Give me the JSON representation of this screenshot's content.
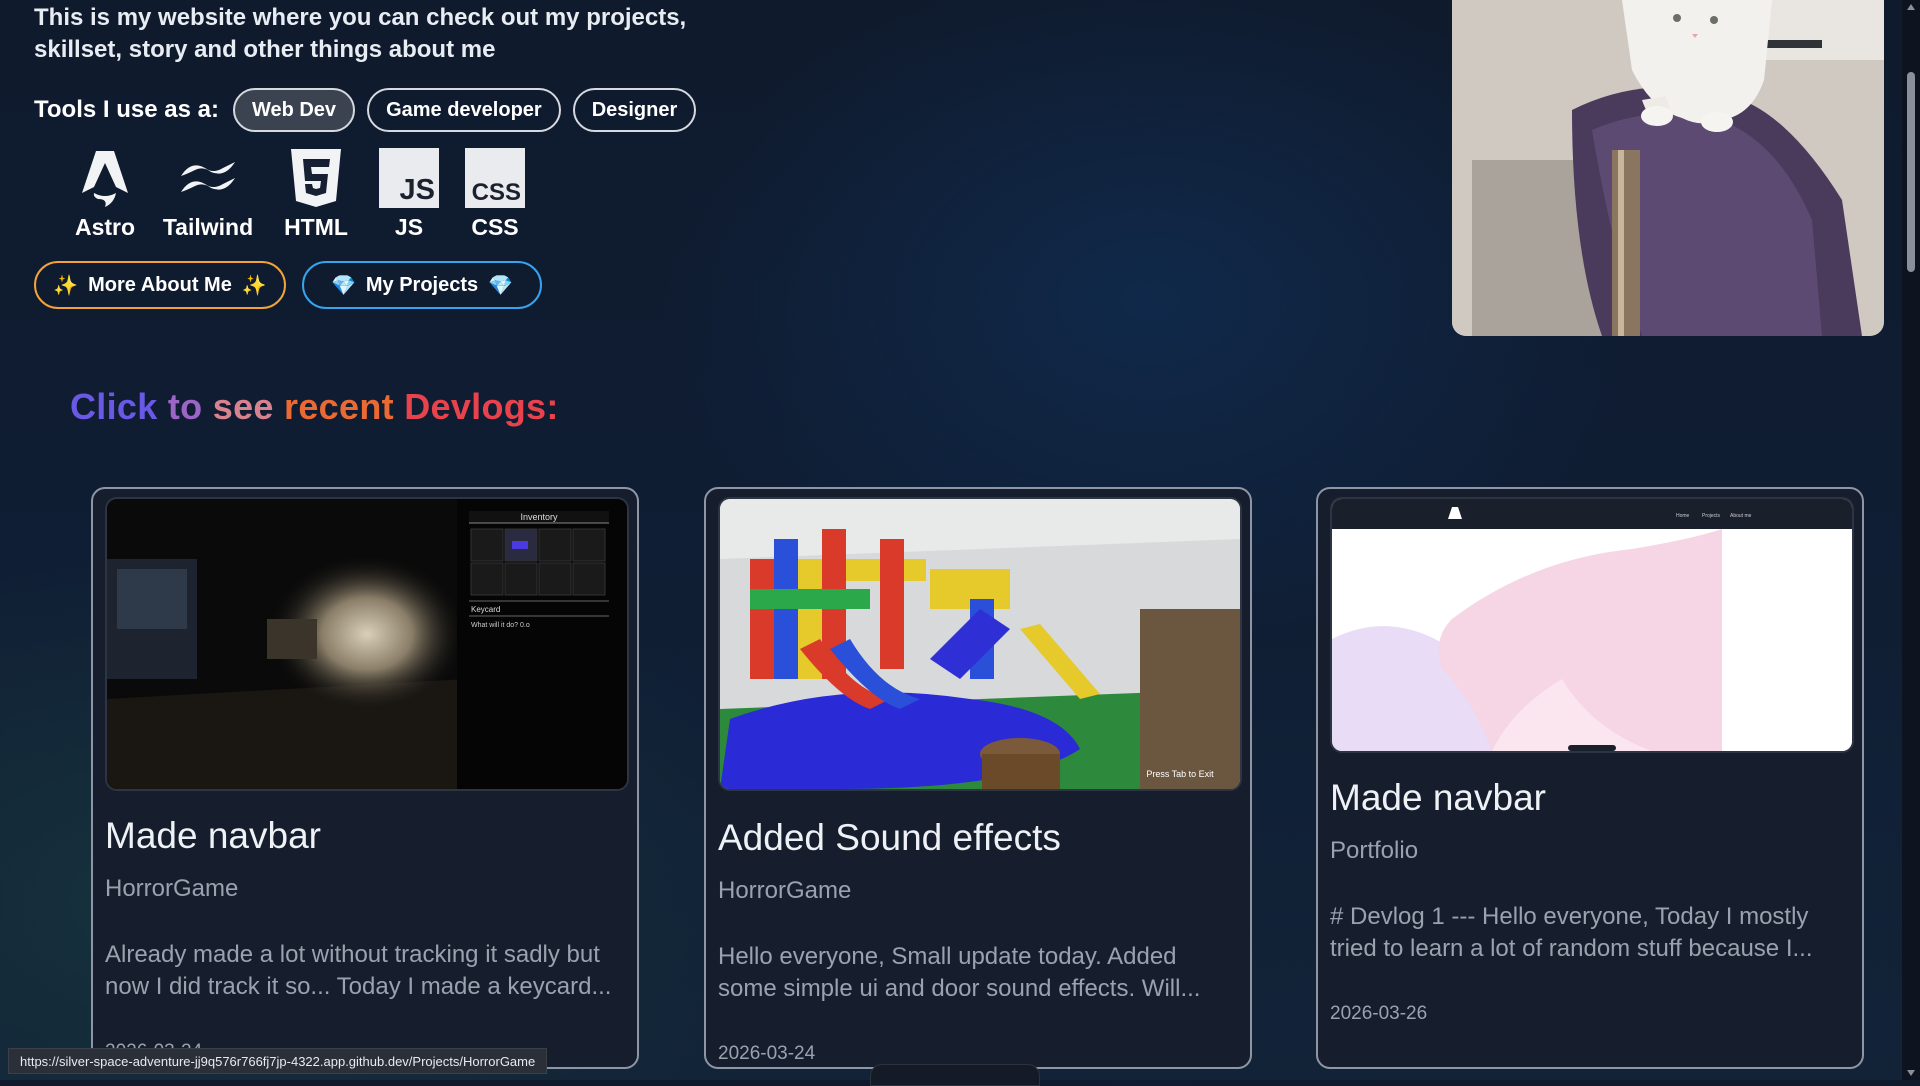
{
  "intro": {
    "line1": "This is my website where you can check out my projects,",
    "line2": "skillset, story and other things about me"
  },
  "tools": {
    "label": "Tools I use as a:",
    "roles": [
      "Web Dev",
      "Game developer",
      "Designer"
    ],
    "active_role": "Web Dev",
    "items": [
      {
        "name": "Astro",
        "icon": "astro-icon"
      },
      {
        "name": "Tailwind",
        "icon": "tailwind-icon"
      },
      {
        "name": "HTML",
        "icon": "html5-icon"
      },
      {
        "name": "JS",
        "icon": "js-icon"
      },
      {
        "name": "CSS",
        "icon": "css-icon"
      }
    ]
  },
  "buttons": {
    "about_label": "More About Me",
    "projects_label": "My Projects"
  },
  "devlogs": {
    "heading_words": [
      "Click",
      "to",
      "see",
      "recent",
      "Devlogs:"
    ],
    "cards": [
      {
        "title": "Made navbar",
        "project": "HorrorGame",
        "excerpt": "Already made a lot without tracking it sadly but now I did track it so... Today I made a keycard...",
        "date": "2026-03-24",
        "inventory_title": "Inventory",
        "inventory_item": "Keycard",
        "inventory_desc": "What will it do? 0.o"
      },
      {
        "title": "Added Sound effects",
        "project": "HorrorGame",
        "excerpt": "Hello everyone, Small update today. Added some simple ui and door sound effects. Will...",
        "date": "2026-03-24",
        "hint": "Press Tab to Exit"
      },
      {
        "title": "Made navbar",
        "project": "Portfolio",
        "excerpt": "# Devlog 1 --- Hello everyone, Today I mostly tried to learn a lot of random stuff because I...",
        "date": "2026-03-26",
        "nav_links": [
          "Home",
          "Projects",
          "About me"
        ]
      }
    ]
  },
  "status_bar": {
    "url": "https://silver-space-adventure-jj9q576r766fj7jp-4322.app.github.dev/Projects/HorrorGame"
  }
}
